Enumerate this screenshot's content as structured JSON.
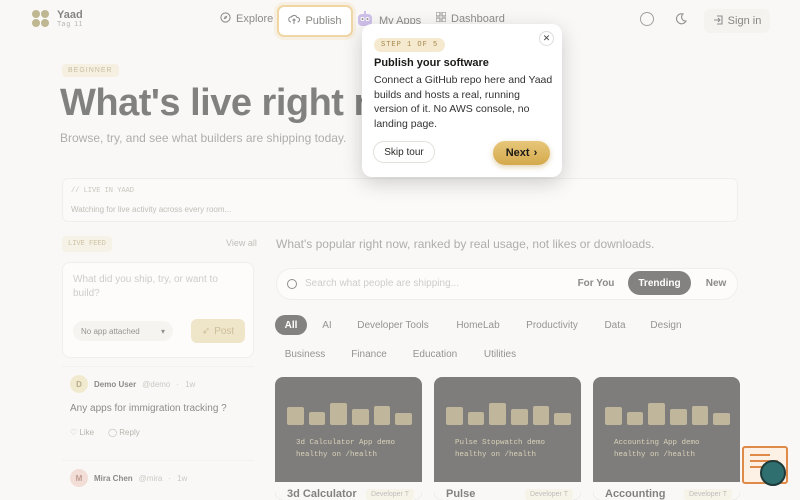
{
  "nav": {
    "brand": "Yaad",
    "brand_sub": "Tag 11",
    "explore": "Explore",
    "publish": "Publish",
    "my_apps": "My Apps",
    "dashboard": "Dashboard",
    "sign_in": "Sign in"
  },
  "hero": {
    "badge": "BEGINNER",
    "title": "What's live right now",
    "subtitle": "Browse, try, and see what builders are shipping today."
  },
  "live_strip": {
    "label": "// LIVE IN YAAD",
    "text": "Watching for live activity across every room..."
  },
  "feed": {
    "badge": "LIVE FEED",
    "view_all": "View all",
    "composer_placeholder": "What did you ship, try, or want to build?",
    "attach_label": "No app attached",
    "post_label": "Post",
    "posts": [
      {
        "initial": "D",
        "name": "Demo User",
        "handle": "@demo",
        "time": "1w",
        "body": "Any apps for immigration tracking ?",
        "like": "Like",
        "reply": "Reply"
      },
      {
        "initial": "M",
        "name": "Mira Chen",
        "handle": "@mira",
        "time": "1w"
      }
    ]
  },
  "discover": {
    "subtitle": "What's popular right now, ranked by real usage, not likes or downloads.",
    "search_placeholder": "Search what people are shipping...",
    "tabs": [
      "For You",
      "Trending",
      "New"
    ],
    "active_tab": "Trending",
    "categories_row1": [
      "All",
      "AI",
      "Developer Tools",
      "HomeLab",
      "Productivity",
      "Data",
      "Design"
    ],
    "categories_row2": [
      "Business",
      "Finance",
      "Education",
      "Utilities"
    ],
    "active_category": "All"
  },
  "apps": [
    {
      "name": "3d Calculator",
      "line1": "3d Calculator App demo",
      "line2": "healthy on /health",
      "tag": "Developer T",
      "bars": [
        0.75,
        0.55,
        0.9,
        0.65,
        0.8,
        0.5
      ]
    },
    {
      "name": "Pulse",
      "line1": "Pulse Stopwatch demo",
      "line2": "healthy on /health",
      "tag": "Developer T",
      "bars": [
        0.75,
        0.55,
        0.9,
        0.65,
        0.8,
        0.5
      ]
    },
    {
      "name": "Accounting",
      "line1": "Accounting App demo",
      "line2": "healthy on /health",
      "tag": "Developer T",
      "bars": [
        0.75,
        0.55,
        0.9,
        0.65,
        0.8,
        0.5
      ]
    }
  ],
  "tour": {
    "step": "STEP 1 OF 5",
    "title": "Publish your software",
    "body": "Connect a GitHub repo here and Yaad builds and hosts a real, running version of it. No AWS console, no landing page.",
    "skip": "Skip tour",
    "next": "Next"
  },
  "colors": {
    "accent": "#e3b55a",
    "dark": "#1e1d1a",
    "background": "#f4f3ef"
  }
}
